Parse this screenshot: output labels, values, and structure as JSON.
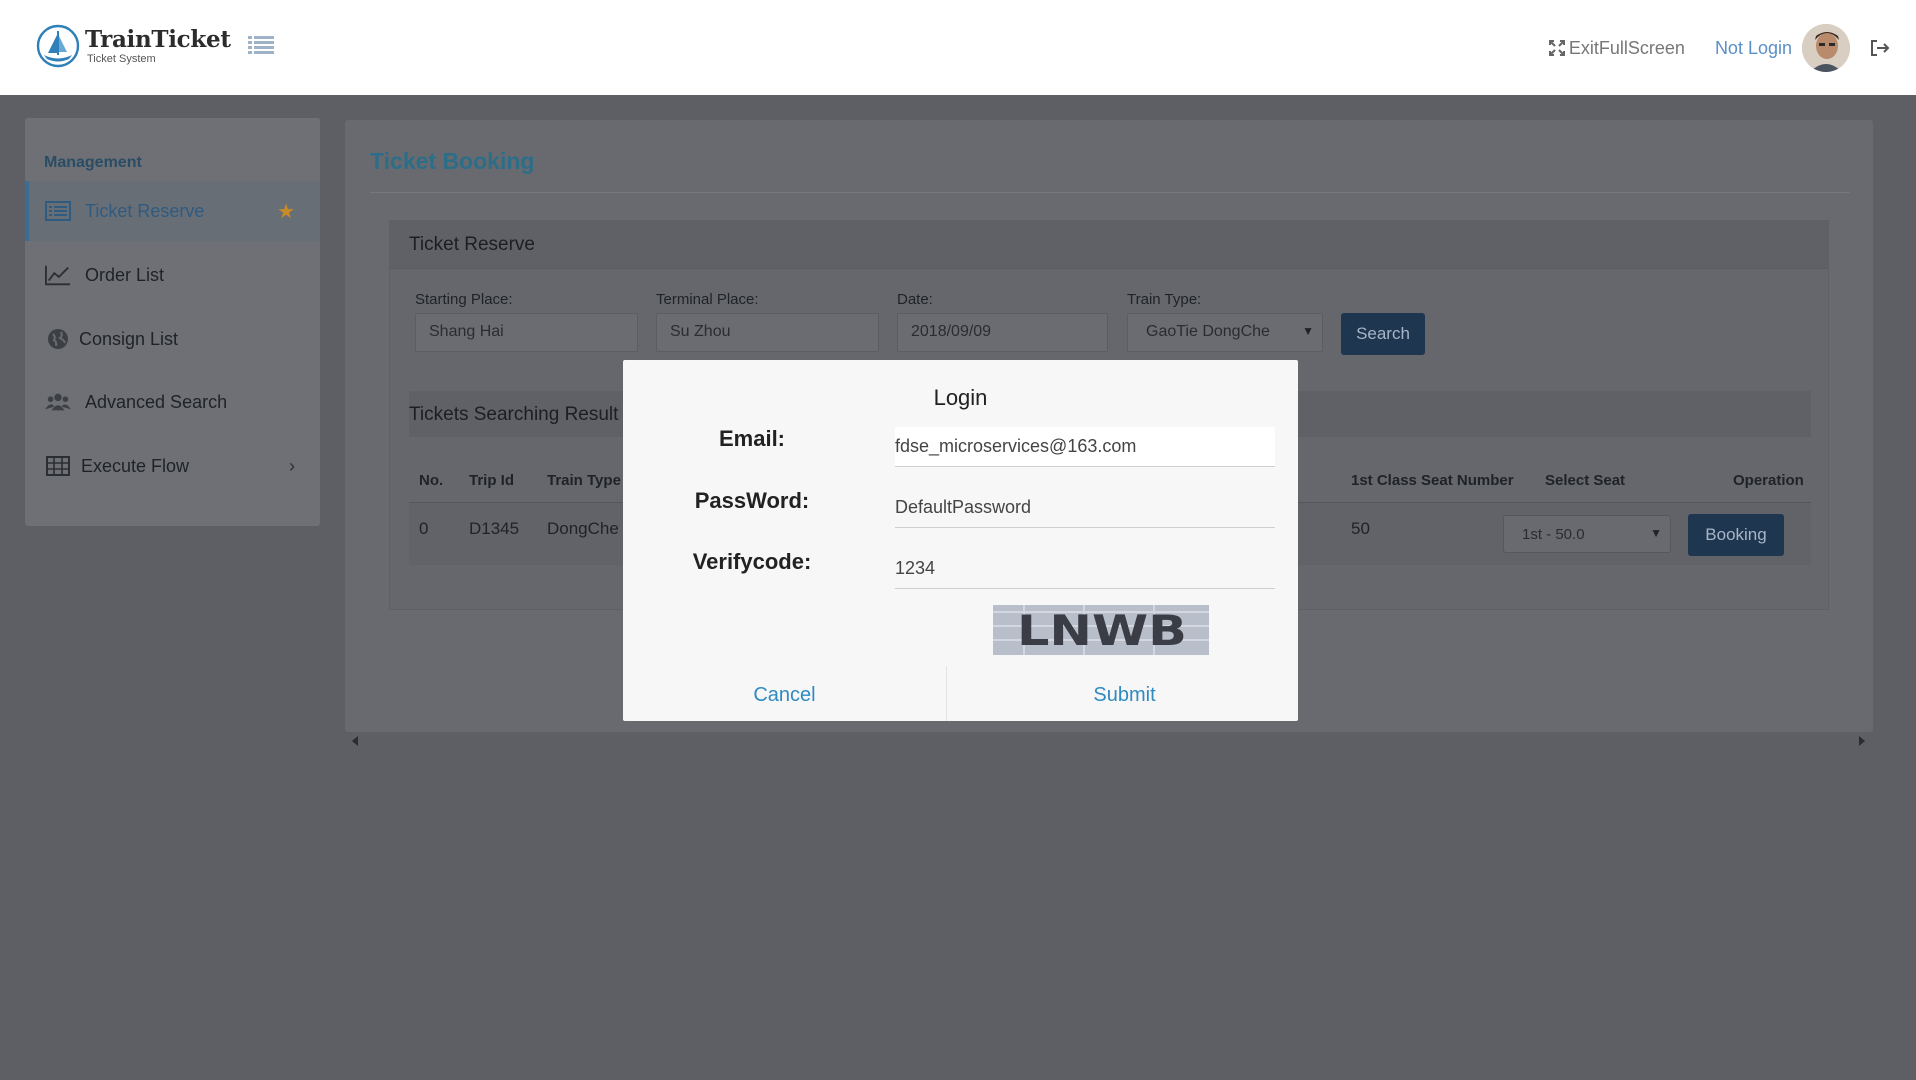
{
  "header": {
    "logo_title": "TrainTicket",
    "logo_subtitle": "Ticket System",
    "fullscreen_label": "ExitFullScreen",
    "login_label": "Not Login"
  },
  "sidebar": {
    "heading": "Management",
    "items": [
      {
        "label": "Ticket Reserve",
        "icon": "list-icon",
        "active": true
      },
      {
        "label": "Order List",
        "icon": "line-chart-icon"
      },
      {
        "label": "Consign List",
        "icon": "globe-icon"
      },
      {
        "label": "Advanced Search",
        "icon": "users-icon"
      },
      {
        "label": "Execute Flow",
        "icon": "table-icon"
      }
    ]
  },
  "main": {
    "title": "Ticket Booking",
    "reserve_title": "Ticket Reserve",
    "fields": {
      "starting_label": "Starting Place:",
      "starting_value": "Shang Hai",
      "terminal_label": "Terminal Place:",
      "terminal_value": "Su Zhou",
      "date_label": "Date:",
      "date_value": "2018/09/09",
      "train_type_label": "Train Type:",
      "train_type_value": "GaoTie DongChe"
    },
    "search_label": "Search",
    "results_title": "Tickets Searching Result",
    "columns": {
      "no": "No.",
      "trip_id": "Trip Id",
      "train_type": "Train Type",
      "first_class": "1st Class Seat Number",
      "select_seat": "Select Seat",
      "operation": "Operation"
    },
    "row": {
      "no": "0",
      "trip_id": "D1345",
      "train_type": "DongChe",
      "first_class": "50",
      "seat": "1st - 50.0",
      "booking_label": "Booking"
    }
  },
  "modal": {
    "title": "Login",
    "email_label": "Email:",
    "email_value": "fdse_microservices@163.com",
    "password_label": "PassWord:",
    "password_value": "DefaultPassword",
    "verify_label": "Verifycode:",
    "verify_value": "1234",
    "captcha_text": "LNWB",
    "cancel_label": "Cancel",
    "submit_label": "Submit"
  },
  "colors": {
    "accent": "#2f8ac0",
    "brand_title": "#2c6e88",
    "button_dark": "#1f3650",
    "overlay": "#5d5f65"
  }
}
